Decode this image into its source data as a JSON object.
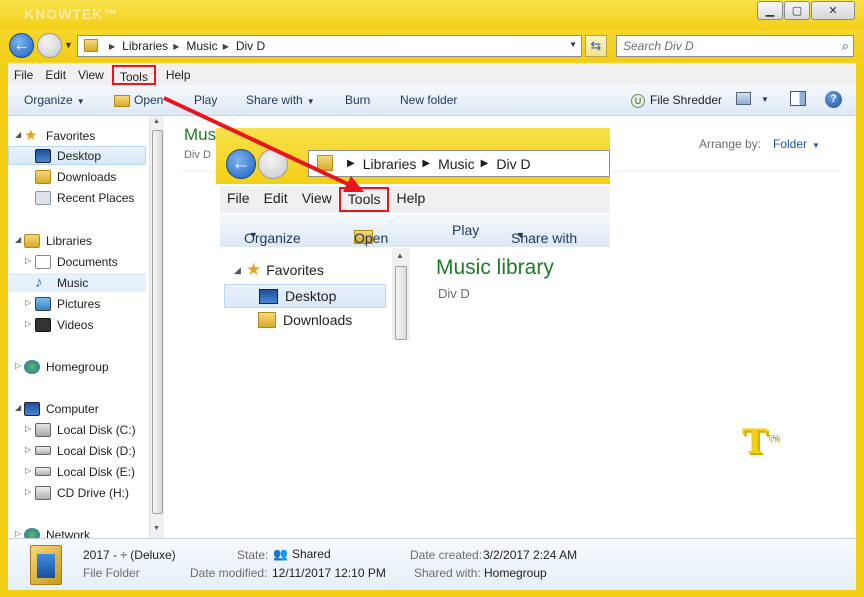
{
  "window": {
    "watermark": "KNOWTEK™",
    "controls": {
      "minimize": "▁",
      "maximize": "▢",
      "close": "✕"
    }
  },
  "address": {
    "crumbs": [
      "Libraries",
      "Music",
      "Div D"
    ],
    "search_placeholder": "Search Div D"
  },
  "menu": [
    "File",
    "Edit",
    "View",
    "Tools",
    "Help"
  ],
  "toolbar": {
    "organize": "Organize",
    "open": "Open",
    "play": "Play",
    "share_with": "Share with",
    "burn": "Burn",
    "new_folder": "New folder",
    "file_shredder": "File Shredder"
  },
  "nav": {
    "favorites": "Favorites",
    "desktop": "Desktop",
    "downloads": "Downloads",
    "recent_places": "Recent Places",
    "libraries": "Libraries",
    "documents": "Documents",
    "music": "Music",
    "pictures": "Pictures",
    "videos": "Videos",
    "homegroup": "Homegroup",
    "computer": "Computer",
    "local_c": "Local Disk (C:)",
    "local_d": "Local Disk (D:)",
    "local_e": "Local Disk (E:)",
    "cd_drive": "CD Drive (H:)",
    "network": "Network"
  },
  "content": {
    "title": "Music library",
    "subtitle": "Div D",
    "arrange_label": "Arrange by:",
    "arrange_value": "Folder"
  },
  "details": {
    "name": "2017 - ÷ (Deluxe)",
    "type": "File Folder",
    "state_label": "State:",
    "state_value": "Shared",
    "modified_label": "Date modified:",
    "modified_value": "12/11/2017 12:10 PM",
    "created_label": "Date created:",
    "created_value": "3/2/2017 2:24 AM",
    "shared_label": "Shared with:",
    "shared_value": "Homegroup"
  },
  "colors": {
    "window_frame": "#f3cf16",
    "highlight_box": "#e8141e",
    "library_title": "#1e7b26",
    "link_blue": "#1f55a8"
  },
  "logo_text": "T"
}
